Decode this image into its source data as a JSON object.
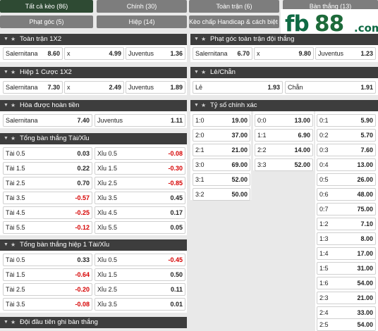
{
  "tabs": [
    {
      "label": "Tất cả kèo (86)",
      "active": true
    },
    {
      "label": "Chính (30)",
      "active": false
    },
    {
      "label": "Toàn trận (6)",
      "active": false
    },
    {
      "label": "Bàn thắng (13)",
      "active": false
    },
    {
      "label": "Phạt góc (5)",
      "active": false
    },
    {
      "label": "Hiệp (14)",
      "active": false
    },
    {
      "label": "Kèo chấp Handicap & cách biệt (5)",
      "active": false
    }
  ],
  "logo": {
    "text_fb": "fb",
    "text_88": "88",
    "text_com": ".com"
  },
  "icons": {
    "collapse": "chevron-down-icon",
    "favorite": "star-icon"
  },
  "colors": {
    "header_bg": "#3d3d3d",
    "tab_active": "#2e4a33",
    "tab": "#7d7d7d",
    "negative": "#d60000",
    "logo_green": "#0f6a44"
  },
  "sections": {
    "full_1x2": {
      "title": "Toàn trận 1X2",
      "cells": [
        {
          "label": "Salernitana",
          "odd": "8.60"
        },
        {
          "label": "x",
          "odd": "4.99"
        },
        {
          "label": "Juventus",
          "odd": "1.36"
        }
      ]
    },
    "h1_1x2": {
      "title": "Hiệp 1 Cược 1X2",
      "cells": [
        {
          "label": "Salernitana",
          "odd": "7.30"
        },
        {
          "label": "x",
          "odd": "2.49"
        },
        {
          "label": "Juventus",
          "odd": "1.89"
        }
      ]
    },
    "dnb": {
      "title": "Hòa được hoàn tiền",
      "cells": [
        {
          "label": "Salernitana",
          "odd": "7.40"
        },
        {
          "label": "Juventus",
          "odd": "1.11"
        }
      ]
    },
    "total_goals": {
      "title": "Tổng bàn thắng Tài/Xỉu",
      "rows": [
        [
          {
            "label": "Tài 0.5",
            "odd": "0.03"
          },
          {
            "label": "Xỉu 0.5",
            "odd": "-0.08"
          }
        ],
        [
          {
            "label": "Tài 1.5",
            "odd": "0.22"
          },
          {
            "label": "Xỉu 1.5",
            "odd": "-0.30"
          }
        ],
        [
          {
            "label": "Tài 2.5",
            "odd": "0.70"
          },
          {
            "label": "Xỉu 2.5",
            "odd": "-0.85"
          }
        ],
        [
          {
            "label": "Tài 3.5",
            "odd": "-0.57"
          },
          {
            "label": "Xỉu 3.5",
            "odd": "0.45"
          }
        ],
        [
          {
            "label": "Tài 4.5",
            "odd": "-0.25"
          },
          {
            "label": "Xỉu 4.5",
            "odd": "0.17"
          }
        ],
        [
          {
            "label": "Tài 5.5",
            "odd": "-0.12"
          },
          {
            "label": "Xỉu 5.5",
            "odd": "0.05"
          }
        ]
      ]
    },
    "h1_total": {
      "title": "Tổng bàn thắng hiệp 1 Tài/Xỉu",
      "rows": [
        [
          {
            "label": "Tài 0.5",
            "odd": "0.33"
          },
          {
            "label": "Xỉu 0.5",
            "odd": "-0.45"
          }
        ],
        [
          {
            "label": "Tài 1.5",
            "odd": "-0.64"
          },
          {
            "label": "Xỉu 1.5",
            "odd": "0.50"
          }
        ],
        [
          {
            "label": "Tài 2.5",
            "odd": "-0.20"
          },
          {
            "label": "Xỉu 2.5",
            "odd": "0.11"
          }
        ],
        [
          {
            "label": "Tài 3.5",
            "odd": "-0.08"
          },
          {
            "label": "Xỉu 3.5",
            "odd": "0.01"
          }
        ]
      ]
    },
    "first_scorer": {
      "title": "Đội đầu tiên ghi bàn thắng"
    },
    "corner_1x2": {
      "title": "Phạt góc toàn trận đội thắng",
      "cells": [
        {
          "label": "Salernitana",
          "odd": "6.70"
        },
        {
          "label": "x",
          "odd": "9.80"
        },
        {
          "label": "Juventus",
          "odd": "1.23"
        }
      ]
    },
    "odd_even": {
      "title": "Lẻ/Chẵn",
      "cells": [
        {
          "label": "Lẻ",
          "odd": "1.93"
        },
        {
          "label": "Chẵn",
          "odd": "1.91"
        }
      ]
    },
    "correct_score": {
      "title": "Tỷ số chính xác",
      "col1": [
        {
          "label": "1:0",
          "odd": "19.00"
        },
        {
          "label": "2:0",
          "odd": "37.00"
        },
        {
          "label": "2:1",
          "odd": "21.00"
        },
        {
          "label": "3:0",
          "odd": "69.00"
        },
        {
          "label": "3:1",
          "odd": "52.00"
        },
        {
          "label": "3:2",
          "odd": "50.00"
        }
      ],
      "col2": [
        {
          "label": "0:0",
          "odd": "13.00"
        },
        {
          "label": "1:1",
          "odd": "6.90"
        },
        {
          "label": "2:2",
          "odd": "14.00"
        },
        {
          "label": "3:3",
          "odd": "52.00"
        }
      ],
      "col3": [
        {
          "label": "0:1",
          "odd": "5.90"
        },
        {
          "label": "0:2",
          "odd": "5.70"
        },
        {
          "label": "0:3",
          "odd": "7.60"
        },
        {
          "label": "0:4",
          "odd": "13.00"
        },
        {
          "label": "0:5",
          "odd": "26.00"
        },
        {
          "label": "0:6",
          "odd": "48.00"
        },
        {
          "label": "0:7",
          "odd": "75.00"
        },
        {
          "label": "1:2",
          "odd": "7.10"
        },
        {
          "label": "1:3",
          "odd": "8.00"
        },
        {
          "label": "1:4",
          "odd": "17.00"
        },
        {
          "label": "1:5",
          "odd": "31.00"
        },
        {
          "label": "1:6",
          "odd": "54.00"
        },
        {
          "label": "2:3",
          "odd": "21.00"
        },
        {
          "label": "2:4",
          "odd": "33.00"
        },
        {
          "label": "2:5",
          "odd": "54.00"
        }
      ]
    }
  }
}
